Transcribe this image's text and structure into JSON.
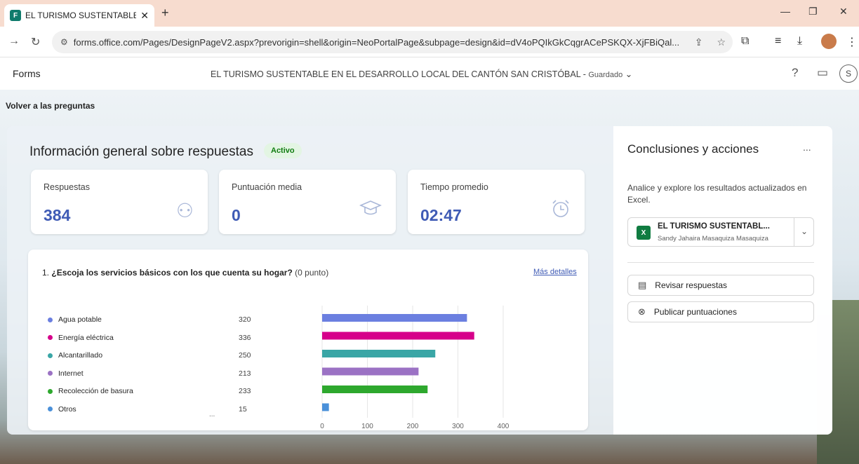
{
  "browser": {
    "tab_title": "EL TURISMO SUSTENTABLE EN",
    "favicon_text": "F",
    "url": "forms.office.com/Pages/DesignPageV2.aspx?prevorigin=shell&origin=NeoPortalPage&subpage=design&id=dV4oPQIkGkCqgrACePSKQX-XjFBiQal..."
  },
  "header": {
    "app_name": "Forms",
    "form_title": "EL TURISMO SUSTENTABLE EN EL DESARROLLO LOCAL DEL CANTÓN SAN CRISTÓBAL",
    "separator": " - ",
    "save_status": "Guardado",
    "avatar_initial": "S"
  },
  "back_link": "Volver a las preguntas",
  "overview": {
    "title": "Información general sobre respuestas",
    "status": "Activo",
    "cards": [
      {
        "label": "Respuestas",
        "value": "384",
        "icon": "people-icon"
      },
      {
        "label": "Puntuación media",
        "value": "0",
        "icon": "graduation-cap-icon"
      },
      {
        "label": "Tiempo promedio",
        "value": "02:47",
        "icon": "alarm-clock-icon"
      }
    ]
  },
  "question": {
    "number": "1.",
    "text": "¿Escoja los servicios básicos con los que cuenta su hogar?",
    "points": "(0 punto)",
    "more_details": "Más detalles",
    "ellipsis": "..."
  },
  "chart_data": {
    "type": "bar",
    "orientation": "horizontal",
    "categories": [
      "Agua potable",
      "Energía eléctrica",
      "Alcantarillado",
      "Internet",
      "Recolección de basura",
      "Otros"
    ],
    "values": [
      320,
      336,
      250,
      213,
      233,
      15
    ],
    "colors": [
      "#6b7fe0",
      "#d6008a",
      "#3aa6a6",
      "#9b72c4",
      "#2ea82e",
      "#4a90d9"
    ],
    "xlim": [
      0,
      400
    ],
    "xticks": [
      0,
      100,
      200,
      300,
      400
    ],
    "grid": true
  },
  "insights": {
    "title": "Conclusiones y acciones",
    "more": "...",
    "description": "Analice y explore los resultados actualizados en Excel.",
    "excel_file": "EL TURISMO SUSTENTABL...",
    "excel_owner": "Sandy Jahaira Masaquiza Masaquiza",
    "review_button": "Revisar respuestas",
    "publish_button": "Publicar puntuaciones"
  }
}
